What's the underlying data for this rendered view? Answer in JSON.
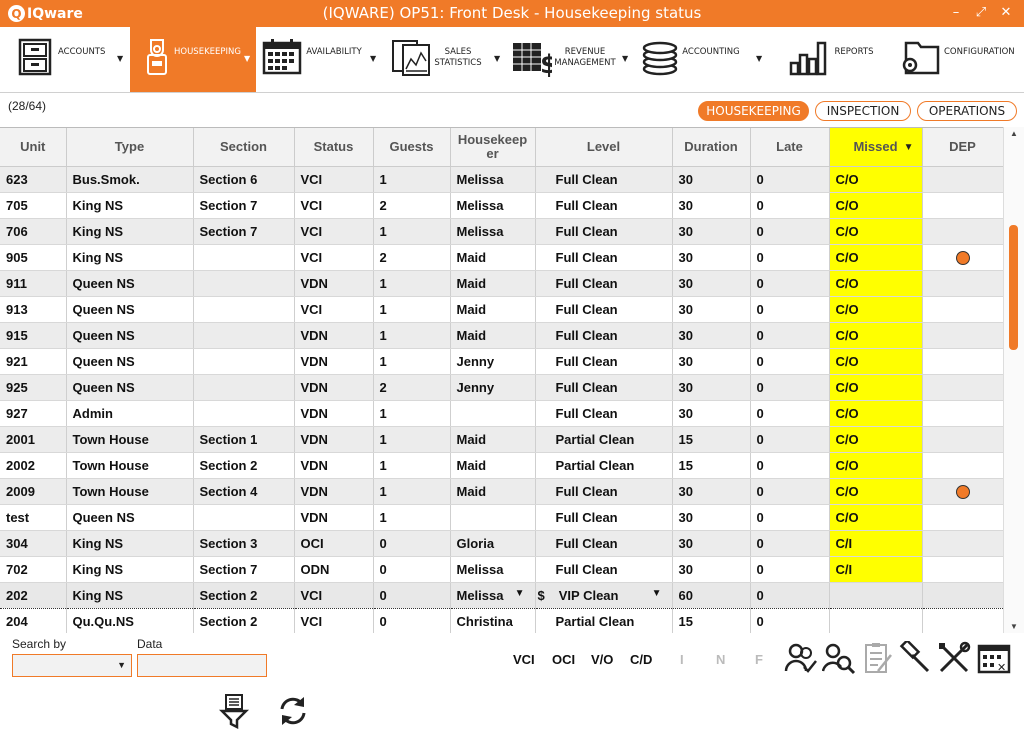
{
  "app": {
    "logo_text": "IQware",
    "title": "(IQWARE) OP51: Front Desk - Housekeeping status",
    "minimize": "–",
    "maximize": "⤢",
    "close": "✕"
  },
  "menu": [
    {
      "label": "ACCOUNTS",
      "icon": "cabinet-icon"
    },
    {
      "label": "HOUSEKEEPING",
      "icon": "door-hanger-icon"
    },
    {
      "label": "AVAILABILITY",
      "icon": "calendar-icon"
    },
    {
      "label": "SALES\nSTATISTICS",
      "icon": "chart-document-icon"
    },
    {
      "label": "REVENUE\nMANAGEMENT",
      "icon": "spreadsheet-dollar-icon"
    },
    {
      "label": "ACCOUNTING",
      "icon": "coin-stack-icon"
    },
    {
      "label": "REPORTS",
      "icon": "bar-chart-icon"
    },
    {
      "label": "CONFIGURATION",
      "icon": "folder-gear-icon"
    }
  ],
  "toolbar": {
    "count": "(28/64)",
    "tabs": [
      "HOUSEKEEPING",
      "INSPECTION",
      "OPERATIONS"
    ]
  },
  "grid": {
    "columns": [
      "Unit",
      "Type",
      "Section",
      "Status",
      "Guests",
      "Housekeeper",
      "Level",
      "Duration",
      "Late",
      "Missed",
      "DEP"
    ],
    "rows": [
      {
        "unit": "623",
        "type": "Bus.Smok.",
        "section": "Section 6",
        "status": "VCI",
        "guests": "1",
        "hk": "Melissa",
        "level": "Full Clean",
        "duration": "30",
        "late": "0",
        "missed": "C/O",
        "dep": false
      },
      {
        "unit": "705",
        "type": "King NS",
        "section": "Section 7",
        "status": "VCI",
        "guests": "2",
        "hk": "Melissa",
        "level": "Full Clean",
        "duration": "30",
        "late": "0",
        "missed": "C/O",
        "dep": false
      },
      {
        "unit": "706",
        "type": "King NS",
        "section": "Section 7",
        "status": "VCI",
        "guests": "1",
        "hk": "Melissa",
        "level": "Full Clean",
        "duration": "30",
        "late": "0",
        "missed": "C/O",
        "dep": false
      },
      {
        "unit": "905",
        "type": "King NS",
        "section": "",
        "status": "VCI",
        "guests": "2",
        "hk": "Maid",
        "level": "Full Clean",
        "duration": "30",
        "late": "0",
        "missed": "C/O",
        "dep": true
      },
      {
        "unit": "911",
        "type": "Queen NS",
        "section": "",
        "status": "VDN",
        "guests": "1",
        "hk": "Maid",
        "level": "Full Clean",
        "duration": "30",
        "late": "0",
        "missed": "C/O",
        "dep": false
      },
      {
        "unit": "913",
        "type": "Queen NS",
        "section": "",
        "status": "VCI",
        "guests": "1",
        "hk": "Maid",
        "level": "Full Clean",
        "duration": "30",
        "late": "0",
        "missed": "C/O",
        "dep": false
      },
      {
        "unit": "915",
        "type": "Queen NS",
        "section": "",
        "status": "VDN",
        "guests": "1",
        "hk": "Maid",
        "level": "Full Clean",
        "duration": "30",
        "late": "0",
        "missed": "C/O",
        "dep": false
      },
      {
        "unit": "921",
        "type": "Queen NS",
        "section": "",
        "status": "VDN",
        "guests": "1",
        "hk": "Jenny",
        "level": "Full Clean",
        "duration": "30",
        "late": "0",
        "missed": "C/O",
        "dep": false
      },
      {
        "unit": "925",
        "type": "Queen NS",
        "section": "",
        "status": "VDN",
        "guests": "2",
        "hk": "Jenny",
        "level": "Full Clean",
        "duration": "30",
        "late": "0",
        "missed": "C/O",
        "dep": false
      },
      {
        "unit": "927",
        "type": "Admin",
        "section": "",
        "status": "VDN",
        "guests": "1",
        "hk": "",
        "level": "Full Clean",
        "duration": "30",
        "late": "0",
        "missed": "C/O",
        "dep": false
      },
      {
        "unit": "2001",
        "type": "Town House",
        "section": "Section 1",
        "status": "VDN",
        "guests": "1",
        "hk": "Maid",
        "level": "Partial Clean",
        "duration": "15",
        "late": "0",
        "missed": "C/O",
        "dep": false
      },
      {
        "unit": "2002",
        "type": "Town House",
        "section": "Section 2",
        "status": "VDN",
        "guests": "1",
        "hk": "Maid",
        "level": "Partial Clean",
        "duration": "15",
        "late": "0",
        "missed": "C/O",
        "dep": false
      },
      {
        "unit": "2009",
        "type": "Town House",
        "section": "Section 4",
        "status": "VDN",
        "guests": "1",
        "hk": "Maid",
        "level": "Full Clean",
        "duration": "30",
        "late": "0",
        "missed": "C/O",
        "dep": true
      },
      {
        "unit": "test",
        "type": "Queen NS",
        "section": "",
        "status": "VDN",
        "guests": "1",
        "hk": "",
        "level": "Full Clean",
        "duration": "30",
        "late": "0",
        "missed": "C/O",
        "dep": false
      },
      {
        "unit": "304",
        "type": "King NS",
        "section": "Section 3",
        "status": "OCI",
        "guests": "0",
        "hk": "Gloria",
        "level": "Full Clean",
        "duration": "30",
        "late": "0",
        "missed": "C/I",
        "dep": false
      },
      {
        "unit": "702",
        "type": "King NS",
        "section": "Section 7",
        "status": "ODN",
        "guests": "0",
        "hk": "Melissa",
        "level": "Full Clean",
        "duration": "30",
        "late": "0",
        "missed": "C/I",
        "dep": false
      },
      {
        "unit": "202",
        "type": "King NS",
        "section": "Section 2",
        "status": "VCI",
        "guests": "0",
        "hk": "Melissa",
        "level": "VIP Clean",
        "level_prefix": "$",
        "duration": "60",
        "late": "0",
        "missed": "",
        "dep": false,
        "selected": true
      },
      {
        "unit": "204",
        "type": "Qu.Qu.NS",
        "section": "Section 2",
        "status": "VCI",
        "guests": "0",
        "hk": "Christina",
        "level": "Partial Clean",
        "duration": "15",
        "late": "0",
        "missed": "",
        "dep": false
      }
    ]
  },
  "bottom": {
    "search_by_label": "Search by",
    "data_label": "Data",
    "data_value": "",
    "filters": [
      "VCI",
      "OCI",
      "V/O",
      "C/D",
      "I",
      "N",
      "F"
    ]
  },
  "colors": {
    "accent": "#f07a28",
    "missed_highlight": "#ffff00"
  }
}
